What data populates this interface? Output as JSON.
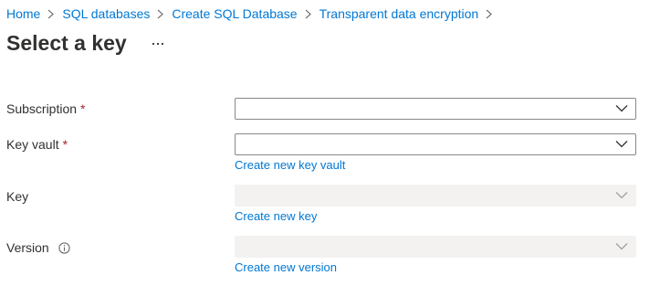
{
  "breadcrumb": {
    "items": [
      "Home",
      "SQL databases",
      "Create SQL Database",
      "Transparent data encryption"
    ]
  },
  "page": {
    "title": "Select a key",
    "more_label": "···"
  },
  "form": {
    "subscription": {
      "label": "Subscription",
      "required_mark": "*",
      "value": ""
    },
    "key_vault": {
      "label": "Key vault",
      "required_mark": "*",
      "value": "",
      "create_link": "Create new key vault"
    },
    "key": {
      "label": "Key",
      "value": "",
      "disabled": true,
      "create_link": "Create new key"
    },
    "version": {
      "label": "Version",
      "value": "",
      "disabled": true,
      "create_link": "Create new version",
      "info_icon": "info-icon"
    }
  },
  "colors": {
    "link": "#0078d4",
    "required": "#a4262c",
    "disabled_field": "#f3f2f1",
    "border": "#8a8886"
  }
}
